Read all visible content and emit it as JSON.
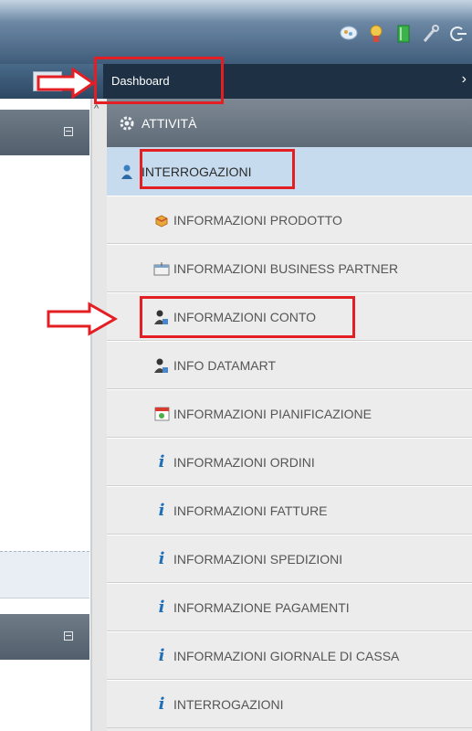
{
  "nav": {
    "dashboard_label": "Dashboard",
    "chevron_glyph": "›"
  },
  "left_panel": {
    "scroll_glyph": "^"
  },
  "menu": {
    "category": {
      "label": "ATTIVITÀ",
      "icon": "gear-icon"
    },
    "selected": {
      "label": "INTERROGAZIONI",
      "icon": "person-icon"
    },
    "items": [
      {
        "label": "INFORMAZIONI PRODOTTO",
        "icon": "product-box-icon"
      },
      {
        "label": "INFORMAZIONI BUSINESS PARTNER",
        "icon": "partner-icon"
      },
      {
        "label": "INFORMAZIONI CONTO",
        "icon": "account-user-icon"
      },
      {
        "label": "INFO DATAMART",
        "icon": "datamart-user-icon"
      },
      {
        "label": "INFORMAZIONI PIANIFICAZIONE",
        "icon": "calendar-icon"
      },
      {
        "label": "INFORMAZIONI ORDINI",
        "icon": "info-icon"
      },
      {
        "label": "INFORMAZIONI FATTURE",
        "icon": "info-icon"
      },
      {
        "label": "INFORMAZIONI SPEDIZIONI",
        "icon": "info-icon"
      },
      {
        "label": "INFORMAZIONE PAGAMENTI",
        "icon": "info-icon"
      },
      {
        "label": "INFORMAZIONI GIORNALE DI CASSA",
        "icon": "info-icon"
      },
      {
        "label": "INTERROGAZIONI",
        "icon": "info-icon"
      }
    ]
  },
  "colors": {
    "callout": "#e41f24",
    "selected_bg": "#c7dbef",
    "menu_bg": "#ececec",
    "text": "#555555",
    "info_icon": "#1f6fb8"
  }
}
